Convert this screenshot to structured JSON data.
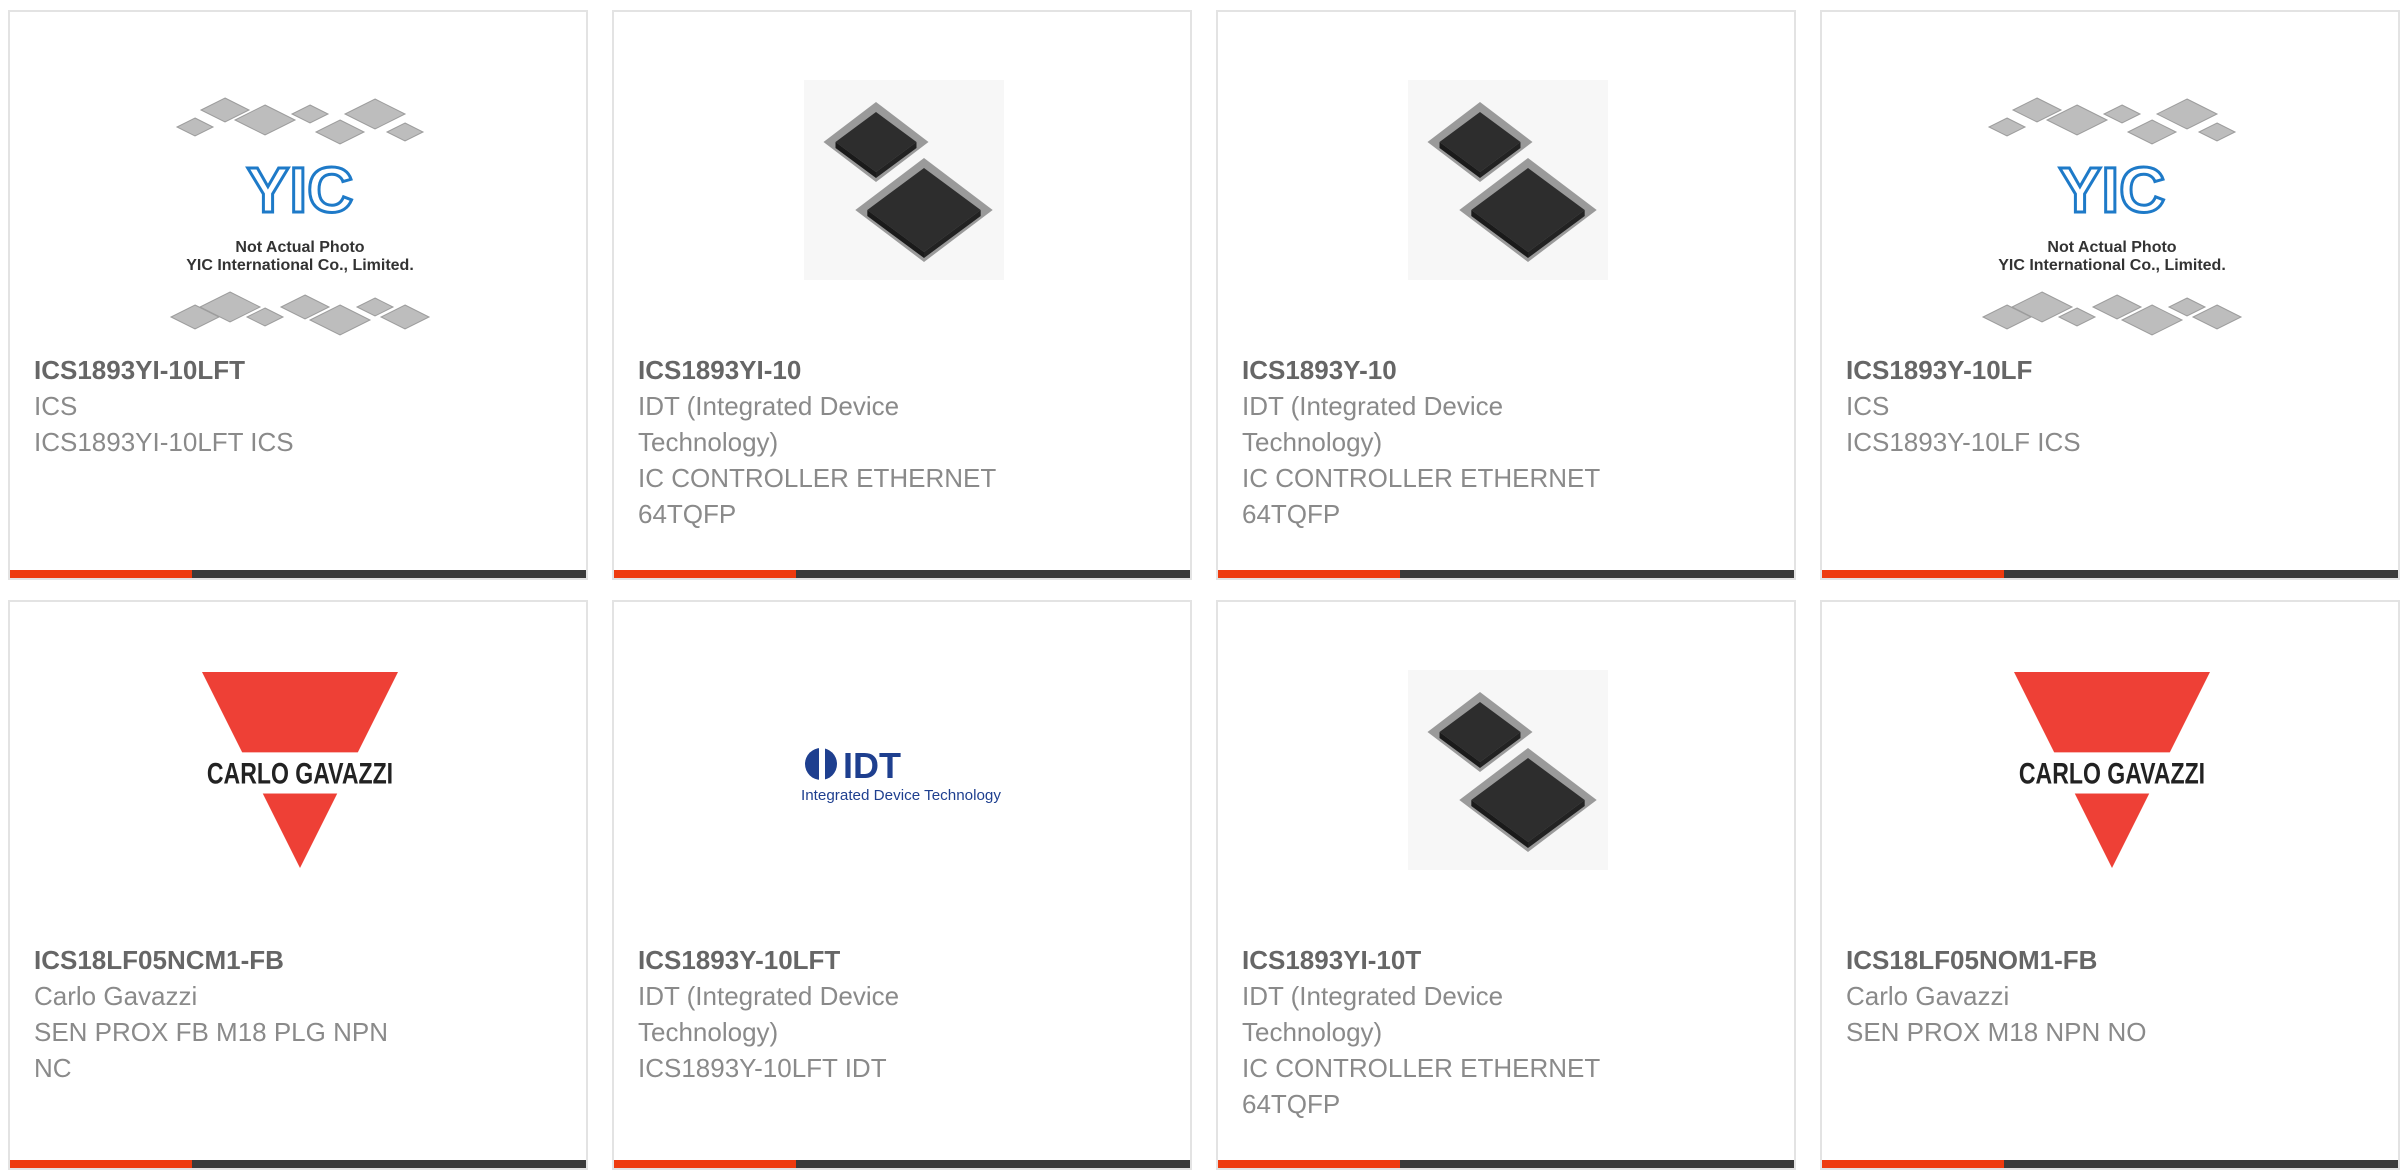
{
  "accent_color": "#ee3b0f",
  "bar_color": "#3b3b3b",
  "products": [
    {
      "image": "yic-placeholder",
      "part": "ICS1893YI-10LFT",
      "manufacturer": [
        "ICS"
      ],
      "description": [
        "ICS1893YI-10LFT ICS"
      ],
      "placeholder_text": [
        "Not Actual Photo",
        "YIC International Co., Limited."
      ]
    },
    {
      "image": "tqfp-chip",
      "part": "ICS1893YI-10",
      "manufacturer": [
        "IDT (Integrated Device",
        "Technology)"
      ],
      "description": [
        "IC CONTROLLER ETHERNET",
        "64TQFP"
      ]
    },
    {
      "image": "tqfp-chip",
      "part": "ICS1893Y-10",
      "manufacturer": [
        "IDT (Integrated Device",
        "Technology)"
      ],
      "description": [
        "IC CONTROLLER ETHERNET",
        "64TQFP"
      ]
    },
    {
      "image": "yic-placeholder",
      "part": "ICS1893Y-10LF",
      "manufacturer": [
        "ICS"
      ],
      "description": [
        "ICS1893Y-10LF ICS"
      ],
      "placeholder_text": [
        "Not Actual Photo",
        "YIC International Co., Limited."
      ]
    },
    {
      "image": "carlo-gavazzi-logo",
      "part": "ICS18LF05NCM1-FB",
      "manufacturer": [
        "Carlo Gavazzi"
      ],
      "description": [
        "SEN PROX FB M18 PLG NPN",
        "NC"
      ]
    },
    {
      "image": "idt-logo",
      "part": "ICS1893Y-10LFT",
      "manufacturer": [
        "IDT (Integrated Device",
        "Technology)"
      ],
      "description": [
        "ICS1893Y-10LFT IDT"
      ]
    },
    {
      "image": "tqfp-chip",
      "part": "ICS1893YI-10T",
      "manufacturer": [
        "IDT (Integrated Device",
        "Technology)"
      ],
      "description": [
        "IC CONTROLLER ETHERNET",
        "64TQFP"
      ]
    },
    {
      "image": "carlo-gavazzi-logo",
      "part": "ICS18LF05NOM1-FB",
      "manufacturer": [
        "Carlo Gavazzi"
      ],
      "description": [
        "SEN PROX M18 NPN NO"
      ]
    }
  ]
}
